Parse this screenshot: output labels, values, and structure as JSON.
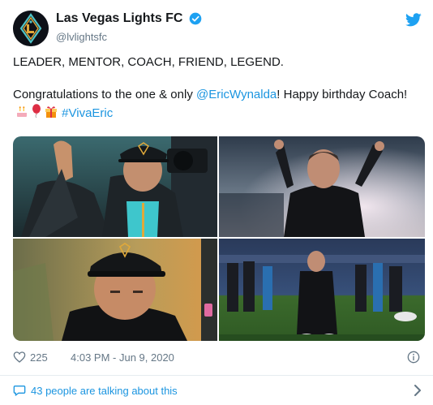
{
  "account": {
    "display_name": "Las Vegas Lights FC",
    "handle": "@lvlightsfc"
  },
  "tweet": {
    "line1": "LEADER, MENTOR, COACH, FRIEND, LEGEND.",
    "line2_before": "Congratulations to the one & only ",
    "mention": "@EricWynalda",
    "line2_after": "! Happy birthday Coach! ",
    "emojis": [
      "cake-emoji",
      "balloon-emoji",
      "gift-emoji"
    ],
    "hashtag": "#VivaEric"
  },
  "media": {
    "photos": [
      "coach-fist-pump-photo",
      "arms-raised-photo",
      "cap-closeup-photo",
      "walking-field-photo"
    ]
  },
  "meta": {
    "like_count": "225",
    "timestamp": "4:03 PM - Jun 9, 2020"
  },
  "conversation": {
    "label": "43 people are talking about this"
  },
  "colors": {
    "link": "#1b95e0",
    "text": "#14171a",
    "muted": "#657786",
    "brand_turquoise": "#4fc3c7",
    "brand_gold": "#e0a93a"
  }
}
